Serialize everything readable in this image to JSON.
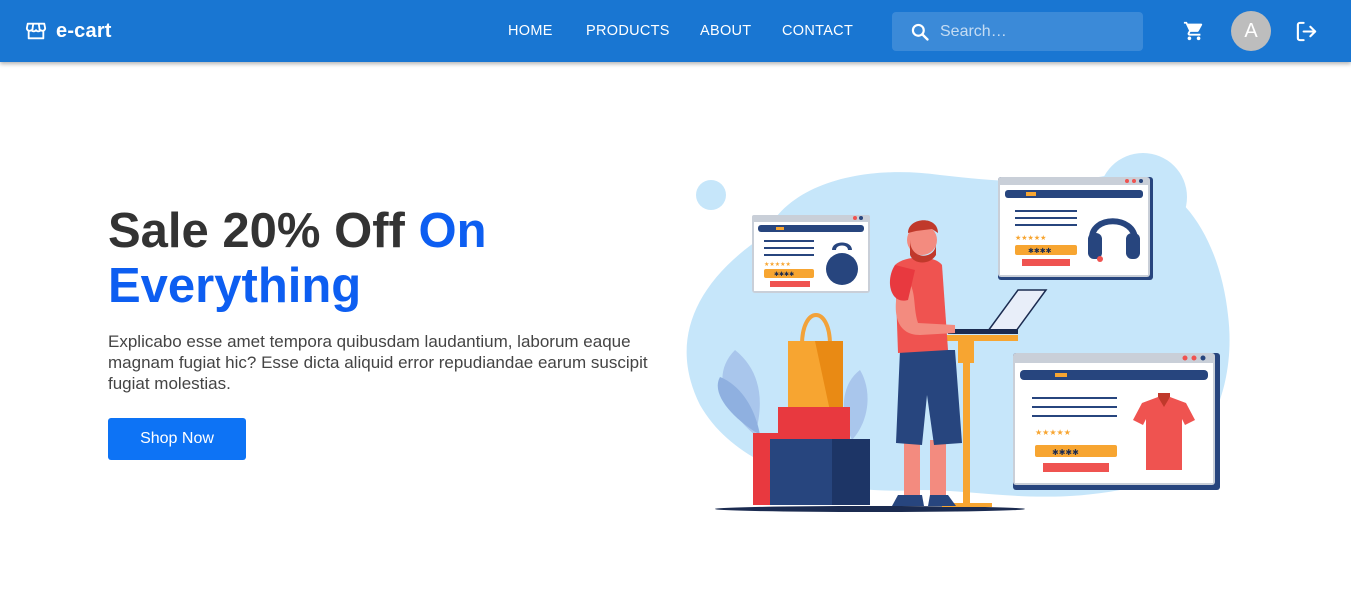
{
  "header": {
    "brand": "e-cart",
    "brand_icon": "storefront-icon",
    "nav": [
      "HOME",
      "PRODUCTS",
      "ABOUT",
      "CONTACT"
    ],
    "search": {
      "placeholder": "Search…",
      "value": ""
    },
    "avatar_letter": "A",
    "background": "#1976d2"
  },
  "hero": {
    "title_dark": "Sale 20% Off",
    "title_accent": "On Everything",
    "description": "Explicabo esse amet tempora quibusdam laudantium, laborum eaque magnam fugiat hic? Esse dicta aliquid error repudiandae earum suscipit fugiat molestias.",
    "button_label": "Shop Now",
    "accent_color": "#0d5ef1",
    "button_color": "#0d73f5"
  },
  "illustration": {
    "rating_stars": "★★★★★",
    "code_stars": "✱✱✱✱"
  }
}
